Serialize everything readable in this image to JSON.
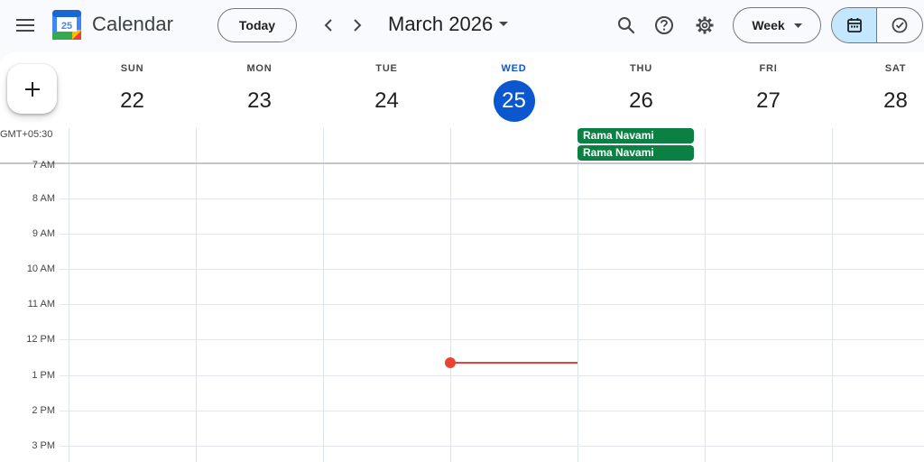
{
  "header": {
    "app_title": "Calendar",
    "logo_day": "25",
    "today_label": "Today",
    "month_title": "March 2026",
    "view_label": "Week"
  },
  "icons": {
    "menu": "hamburger-menu-icon",
    "prev": "chevron-left-icon",
    "next": "chevron-right-icon",
    "search": "search-icon",
    "help": "help-icon",
    "settings": "gear-icon",
    "calendar_view": "calendar-icon",
    "tasks_view": "task-check-icon",
    "create": "plus-icon"
  },
  "colors": {
    "accent_blue": "#0b57d0",
    "event_green": "#0b8043",
    "now_red": "#ea4335",
    "active_toggle": "#c2e7ff"
  },
  "timezone": "GMT+05:30",
  "days": [
    {
      "name": "SUN",
      "num": "22",
      "today": false
    },
    {
      "name": "MON",
      "num": "23",
      "today": false
    },
    {
      "name": "TUE",
      "num": "24",
      "today": false
    },
    {
      "name": "WED",
      "num": "25",
      "today": true
    },
    {
      "name": "THU",
      "num": "26",
      "today": false
    },
    {
      "name": "FRI",
      "num": "27",
      "today": false
    },
    {
      "name": "SAT",
      "num": "28",
      "today": false
    }
  ],
  "hours": [
    "7 AM",
    "8 AM",
    "9 AM",
    "10 AM",
    "11 AM",
    "12 PM",
    "1 PM",
    "2 PM",
    "3 PM"
  ],
  "allday_events": [
    {
      "title": "Rama Navami",
      "day": "THU"
    },
    {
      "title": "Rama Navami",
      "day": "THU"
    }
  ]
}
